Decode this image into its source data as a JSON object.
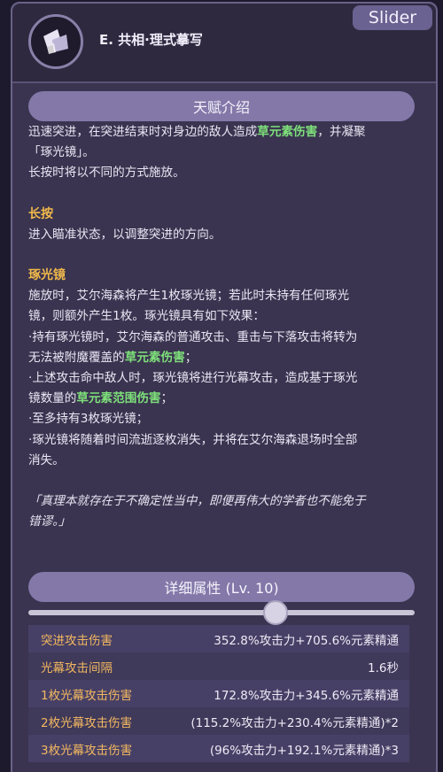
{
  "header": {
    "title": "E. 共相·理式摹写",
    "slider_tag": "Slider"
  },
  "talent": {
    "section_title": "天赋介绍",
    "intro_a": "迅速突进，在突进结束时对身边的敌人造成",
    "intro_hl": "草元素伤害",
    "intro_b": "，并凝聚",
    "intro_line2": "「琢光镜」。",
    "intro_line3": "长按时将以不同的方式施放。",
    "hold_heading": "长按",
    "hold_text": "进入瞄准状态，以调整突进的方向。",
    "mirror_heading": "琢光镜",
    "mirror_l1": "施放时，艾尔海森将产生1枚琢光镜；若此时未持有任何琢光",
    "mirror_l2": "镜，则额外产生1枚。琢光镜具有如下效果：",
    "mirror_l3": "·持有琢光镜时，艾尔海森的普通攻击、重击与下落攻击将转为",
    "mirror_l4a": "无法被附魔覆盖的",
    "mirror_l4hl": "草元素伤害",
    "mirror_l4b": "；",
    "mirror_l5": "·上述攻击命中敌人时，琢光镜将进行光幕攻击，造成基于琢光",
    "mirror_l6a": "镜数量的",
    "mirror_l6hl": "草元素范围伤害",
    "mirror_l6b": "；",
    "mirror_l7": "·至多持有3枚琢光镜；",
    "mirror_l8": "·琢光镜将随着时间流逝逐枚消失，并将在艾尔海森退场时全部",
    "mirror_l9": "消失。",
    "quote_l1": "「真理本就存在于不确定性当中，即便再伟大的学者也不能免于",
    "quote_l2": "错谬。」"
  },
  "details": {
    "section_title": "详细属性 (Lv. 10)",
    "slider_level": 10,
    "slider_fraction": 0.64
  },
  "attributes": [
    {
      "name": "突进攻击伤害",
      "value": "352.8%攻击力+705.6%元素精通"
    },
    {
      "name": "光幕攻击间隔",
      "value": "1.6秒"
    },
    {
      "name": "1枚光幕攻击伤害",
      "value": "172.8%攻击力+345.6%元素精通"
    },
    {
      "name": "2枚光幕攻击伤害",
      "value": "(115.2%攻击力+230.4%元素精通)*2"
    },
    {
      "name": "3枚光幕攻击伤害",
      "value": "(96%攻击力+192.1%元素精通)*3"
    }
  ],
  "colors": {
    "highlight_green": "#7ee07a",
    "heading_orange": "#f0b84a",
    "pill": "#8378a8"
  }
}
